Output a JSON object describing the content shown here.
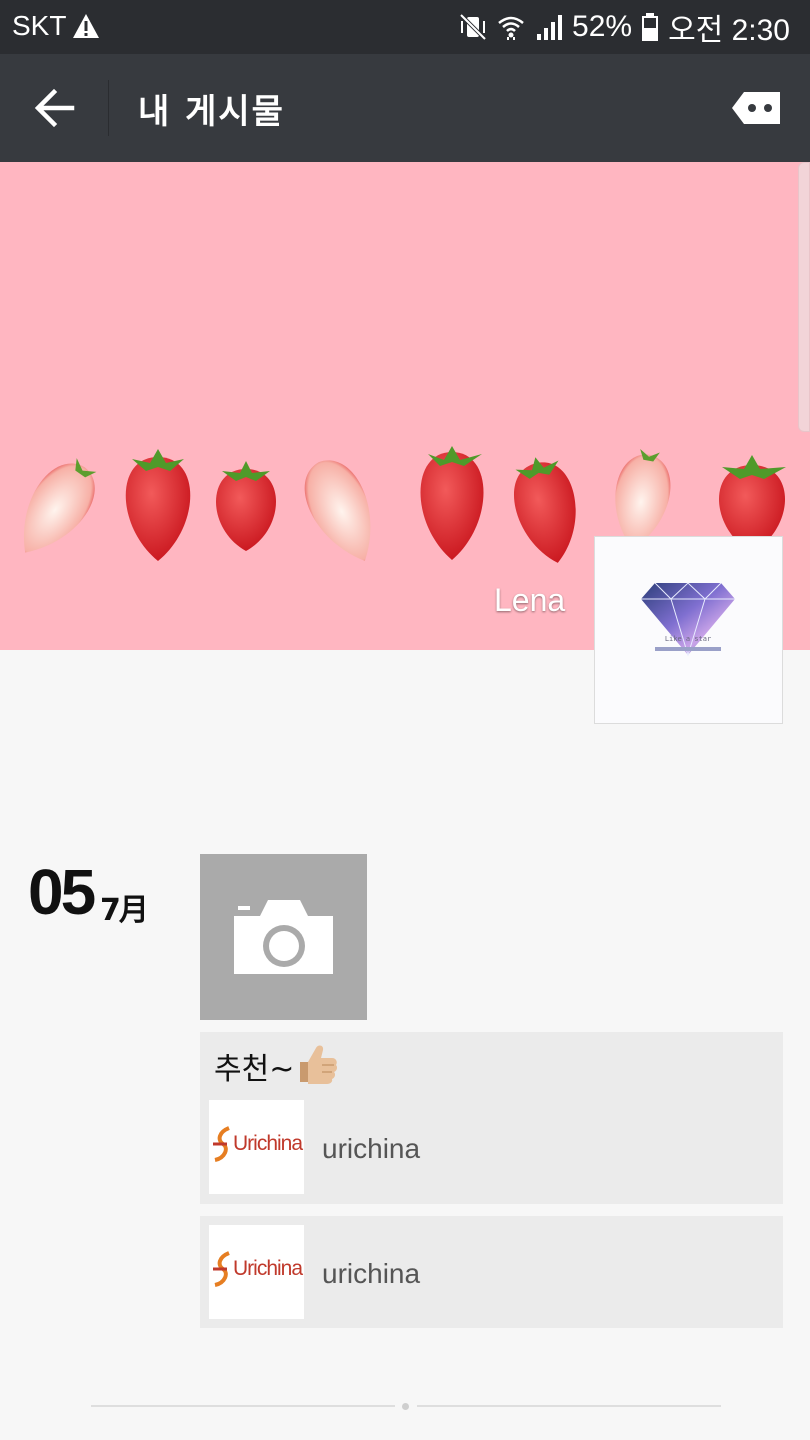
{
  "status_bar": {
    "carrier": "SKT",
    "battery": "52%",
    "time": "오전 2:30"
  },
  "app_bar": {
    "title": "내 게시물"
  },
  "profile": {
    "name": "Lena"
  },
  "post": {
    "day": "05",
    "month": "7月",
    "text": "추천~",
    "links": [
      {
        "brand": "Urichina",
        "title": "urichina"
      },
      {
        "brand": "Urichina",
        "title": "urichina"
      }
    ]
  },
  "colors": {
    "status_bar_bg": "#2b2d31",
    "app_bar_bg": "#373a3f",
    "cover_bg": "#ffb6c1",
    "page_bg": "#f7f7f7",
    "card_bg": "#ebebeb",
    "photo_placeholder_bg": "#aaaaaa",
    "brand_red": "#c0392b",
    "brand_orange": "#e67e22"
  },
  "icons": {
    "warning": "warning-icon",
    "vibrate_off": "vibrate-off-icon",
    "wifi": "wifi-icon",
    "signal": "signal-icon",
    "battery": "battery-icon",
    "back": "back-arrow-icon",
    "more": "more-options-icon",
    "camera": "camera-icon",
    "thumbs_up": "thumbs-up-emoji"
  }
}
